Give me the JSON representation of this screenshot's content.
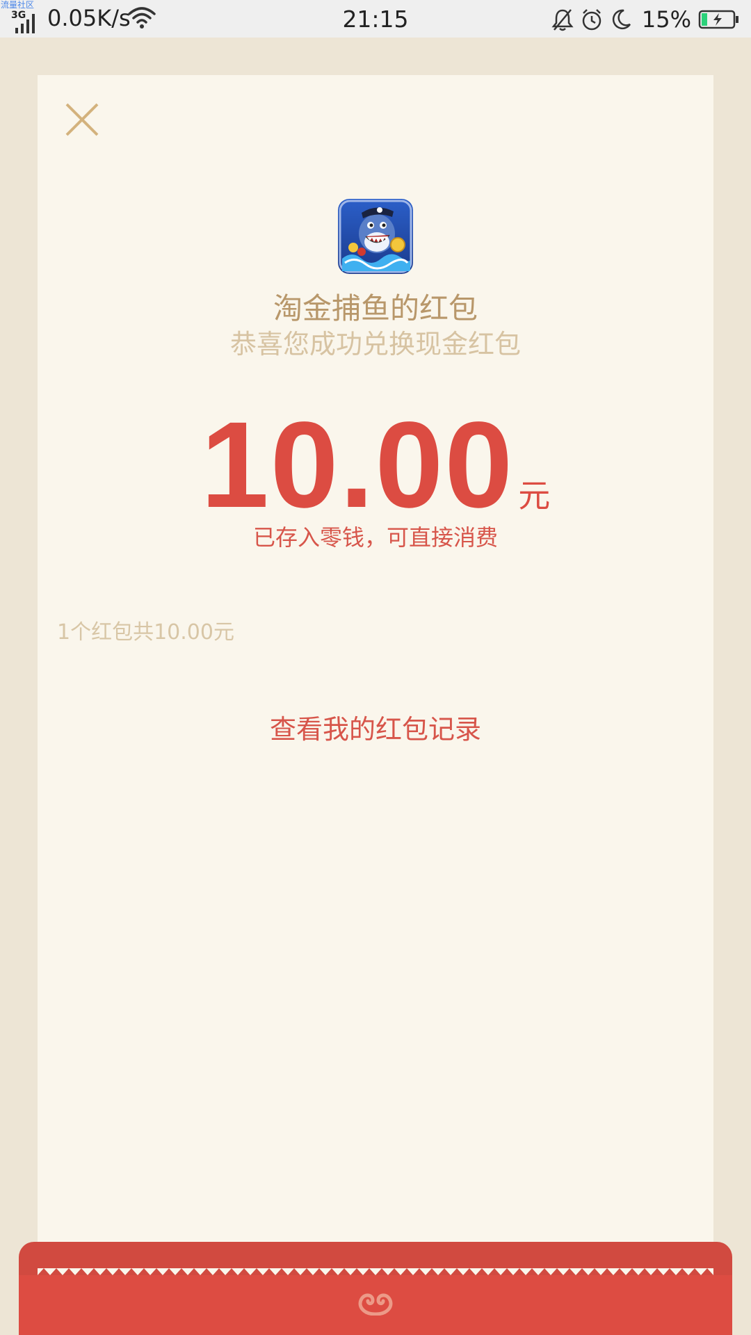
{
  "status_bar": {
    "watermark": "流量社区",
    "network_type": "3G",
    "speed": "0.05K/s",
    "time": "21:15",
    "battery": "15%",
    "icons": [
      "signal-icon",
      "wifi-icon",
      "mute-bell-icon",
      "alarm-icon",
      "moon-icon",
      "battery-charging-icon"
    ]
  },
  "card": {
    "close_icon": "close-icon",
    "app_icon": "shark-game-icon",
    "sender_title": "淘金捕鱼的红包",
    "subtitle": "恭喜您成功兑换现金红包",
    "amount": "10.00",
    "currency": "元",
    "stored_note": "已存入零钱，可直接消费",
    "summary": "1个红包共10.00元",
    "history_link": "查看我的红包记录"
  },
  "colors": {
    "background": "#ede5d5",
    "card": "#faf6ec",
    "accent_red": "#dc4c42",
    "gold_text": "#b8976a",
    "muted_text": "#d8c6a6"
  }
}
